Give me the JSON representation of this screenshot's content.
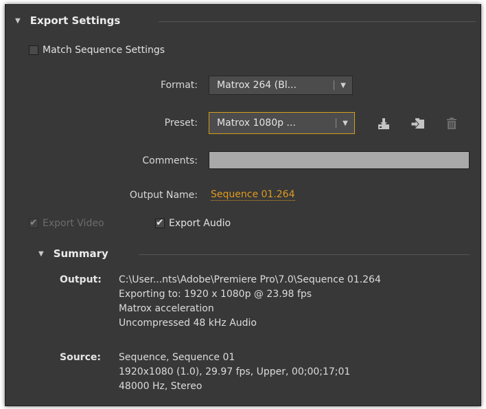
{
  "export_settings": {
    "title": "Export Settings",
    "match_sequence": {
      "label": "Match Sequence Settings",
      "checked": false
    },
    "format": {
      "label": "Format:",
      "value": "Matrox 264 (Bl..."
    },
    "preset": {
      "label": "Preset:",
      "value": "Matrox 1080p ..."
    },
    "preset_icons": [
      "save-preset-icon",
      "import-preset-icon",
      "delete-preset-icon"
    ],
    "comments": {
      "label": "Comments:",
      "value": ""
    },
    "output_name": {
      "label": "Output Name:",
      "value": "Sequence 01.264"
    },
    "export_video": {
      "label": "Export Video",
      "checked": true,
      "disabled": true
    },
    "export_audio": {
      "label": "Export Audio",
      "checked": true
    }
  },
  "summary": {
    "title": "Summary",
    "output_label": "Output:",
    "output_lines": [
      "C:\\User...nts\\Adobe\\Premiere Pro\\7.0\\Sequence 01.264",
      "Exporting to: 1920 x 1080p @ 23.98 fps",
      "Matrox acceleration",
      "Uncompressed 48 kHz Audio"
    ],
    "source_label": "Source:",
    "source_lines": [
      "Sequence, Sequence 01",
      "1920x1080 (1.0), 29.97 fps, Upper, 00;00;17;01",
      "48000 Hz, Stereo"
    ]
  },
  "colors": {
    "panel_bg": "#383838",
    "accent_orange": "#e09a20",
    "focus_border": "#d4a01c",
    "text": "#e2e2e2"
  }
}
